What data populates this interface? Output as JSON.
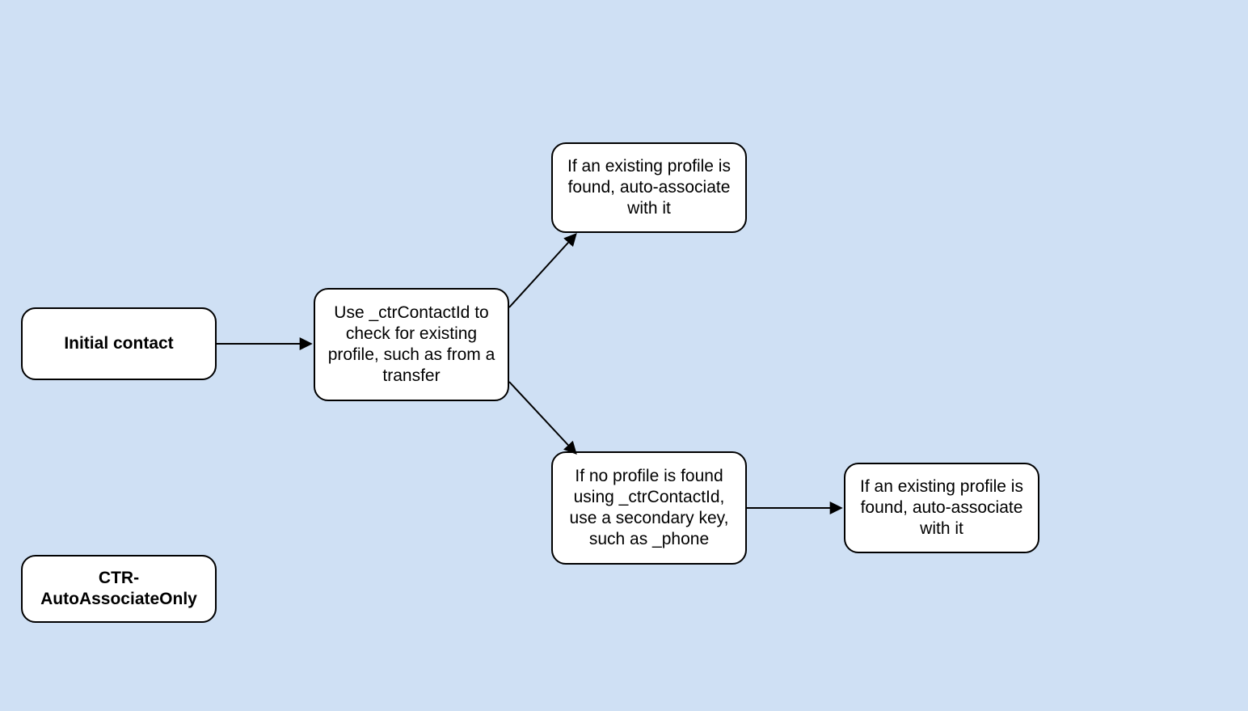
{
  "nodes": {
    "initial_contact": {
      "label": "Initial contact"
    },
    "check_profile": {
      "label": "Use _ctrContactId to check for existing profile, such as from a transfer"
    },
    "found_top": {
      "label": "If an existing profile is found, auto-associate with it"
    },
    "not_found": {
      "label": "If no profile is found using _ctrContactId, use a secondary key, such as _phone"
    },
    "found_right": {
      "label": "If an existing profile is found, auto-associate with it"
    },
    "ctr_auto": {
      "label": "CTR-AutoAssociateOnly"
    }
  }
}
